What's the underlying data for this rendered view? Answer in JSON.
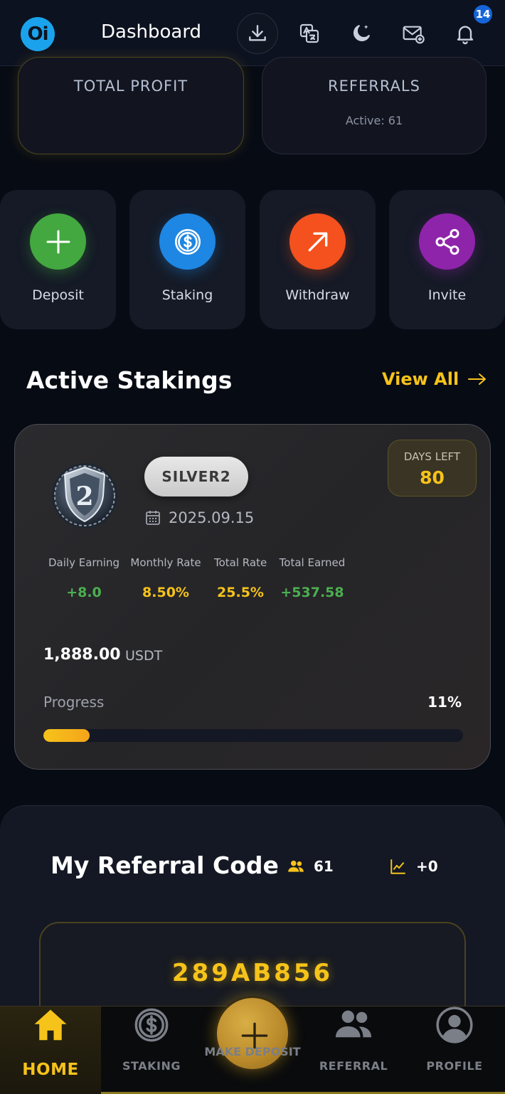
{
  "header": {
    "logo_text": "Oi",
    "title": "Dashboard",
    "notification_count": "14",
    "icons": [
      "download-icon",
      "translate-icon",
      "moon-icon",
      "mail-icon",
      "bell-icon"
    ]
  },
  "stats": {
    "profit_label": "TOTAL PROFIT",
    "referrals_label": "REFERRALS",
    "referrals_active": "Active: 61"
  },
  "actions": [
    {
      "label": "Deposit",
      "icon": "plus-icon",
      "color": "#43a83f"
    },
    {
      "label": "Staking",
      "icon": "dollar-coin-icon",
      "color": "#1e86e3"
    },
    {
      "label": "Withdraw",
      "icon": "arrow-up-right-icon",
      "color": "#f4511e"
    },
    {
      "label": "Invite",
      "icon": "share-icon",
      "color": "#8e24aa"
    }
  ],
  "active_stakings": {
    "title": "Active Stakings",
    "view_all": "View All"
  },
  "staking": {
    "tier": "SILVER2",
    "medal_number": "2",
    "date": "2025.09.15",
    "days_left_label": "DAYS LEFT",
    "days_left": "80",
    "metrics": [
      {
        "label": "Daily Earning",
        "value": "+8.0"
      },
      {
        "label": "Monthly Rate",
        "value": "8.50%"
      },
      {
        "label": "Total Rate",
        "value": "25.5%"
      },
      {
        "label": "Total Earned",
        "value": "+537.58"
      }
    ],
    "amount": "1,888.00",
    "currency": "USDT",
    "progress_label": "Progress",
    "progress_text": "11%",
    "progress": 0.11
  },
  "referral": {
    "title": "My Referral Code",
    "count": "61",
    "growth": "+0",
    "code": "289AB856"
  },
  "bottom_nav": {
    "home": "HOME",
    "staking": "STAKING",
    "make_deposit": "MAKE DEPOSIT",
    "referral": "REFERRAL",
    "profile": "PROFILE"
  },
  "colors": {
    "accent": "#f6c31a",
    "positive": "#4caf50",
    "background": "#070b14"
  }
}
